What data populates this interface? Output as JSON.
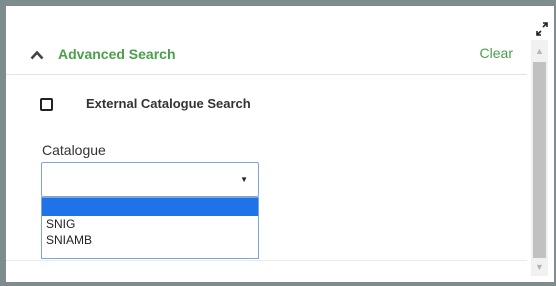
{
  "advanced_search": {
    "title": "Advanced Search",
    "clear_label": "Clear",
    "collapse_icon": "chevron-up-icon",
    "expand_icon": "expand-icon"
  },
  "external_search": {
    "label": "External Catalogue Search",
    "checked": false
  },
  "catalogue": {
    "label": "Catalogue",
    "selected_value": "",
    "options": [
      "",
      "SNIG",
      "SNIAMB"
    ]
  },
  "colors": {
    "accent": "#4aa04a",
    "selection": "#1e73e8",
    "focus_border": "#7aa7d8"
  }
}
